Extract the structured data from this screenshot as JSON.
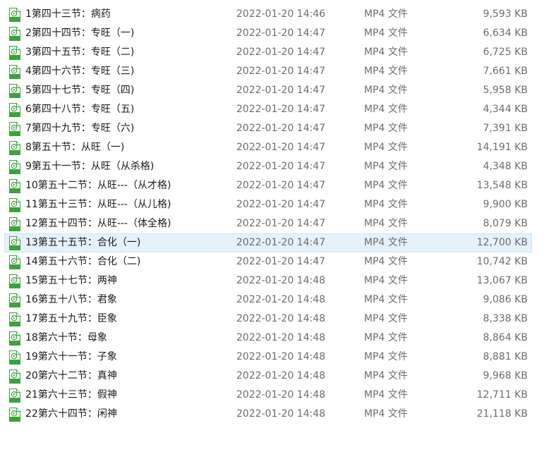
{
  "files": [
    {
      "name": "1第四十三节：病药",
      "date": "2022-01-20 14:46",
      "type": "MP4 文件",
      "size": "9,593 KB"
    },
    {
      "name": "2第四十四节：专旺（一)",
      "date": "2022-01-20 14:47",
      "type": "MP4 文件",
      "size": "6,634 KB"
    },
    {
      "name": "3第四十五节：专旺（二)",
      "date": "2022-01-20 14:47",
      "type": "MP4 文件",
      "size": "6,725 KB"
    },
    {
      "name": "4第四十六节：专旺（三)",
      "date": "2022-01-20 14:47",
      "type": "MP4 文件",
      "size": "7,661 KB"
    },
    {
      "name": "5第四十七节：专旺（四)",
      "date": "2022-01-20 14:47",
      "type": "MP4 文件",
      "size": "5,958 KB"
    },
    {
      "name": "6第四十八节：专旺（五)",
      "date": "2022-01-20 14:47",
      "type": "MP4 文件",
      "size": "4,344 KB"
    },
    {
      "name": "7第四十九节：专旺（六)",
      "date": "2022-01-20 14:47",
      "type": "MP4 文件",
      "size": "7,391 KB"
    },
    {
      "name": "8第五十节：从旺（一)",
      "date": "2022-01-20 14:47",
      "type": "MP4 文件",
      "size": "14,191 KB"
    },
    {
      "name": "9第五十一节：从旺（从杀格)",
      "date": "2022-01-20 14:47",
      "type": "MP4 文件",
      "size": "4,348 KB"
    },
    {
      "name": "10第五十二节：从旺---（从才格)",
      "date": "2022-01-20 14:47",
      "type": "MP4 文件",
      "size": "13,548 KB"
    },
    {
      "name": "11第五十三节：从旺---（从儿格)",
      "date": "2022-01-20 14:47",
      "type": "MP4 文件",
      "size": "9,900 KB"
    },
    {
      "name": "12第五十四节：从旺---（体全格)",
      "date": "2022-01-20 14:47",
      "type": "MP4 文件",
      "size": "8,079 KB"
    },
    {
      "name": "13第五十五节：合化（一)",
      "date": "2022-01-20 14:47",
      "type": "MP4 文件",
      "size": "12,700 KB",
      "selected": true
    },
    {
      "name": "14第五十六节：合化（二)",
      "date": "2022-01-20 14:47",
      "type": "MP4 文件",
      "size": "10,742 KB"
    },
    {
      "name": "15第五十七节：两神",
      "date": "2022-01-20 14:48",
      "type": "MP4 文件",
      "size": "13,067 KB"
    },
    {
      "name": "16第五十八节：君象",
      "date": "2022-01-20 14:48",
      "type": "MP4 文件",
      "size": "9,086 KB"
    },
    {
      "name": "17第五十九节：臣象",
      "date": "2022-01-20 14:48",
      "type": "MP4 文件",
      "size": "8,338 KB"
    },
    {
      "name": "18第六十节：母象",
      "date": "2022-01-20 14:48",
      "type": "MP4 文件",
      "size": "8,864 KB"
    },
    {
      "name": "19第六十一节：子象",
      "date": "2022-01-20 14:48",
      "type": "MP4 文件",
      "size": "8,881 KB"
    },
    {
      "name": "20第六十二节：真神",
      "date": "2022-01-20 14:48",
      "type": "MP4 文件",
      "size": "9,968 KB"
    },
    {
      "name": "21第六十三节：假神",
      "date": "2022-01-20 14:48",
      "type": "MP4 文件",
      "size": "12,711 KB"
    },
    {
      "name": "22第六十四节：闲神",
      "date": "2022-01-20 14:48",
      "type": "MP4 文件",
      "size": "21,118 KB"
    }
  ],
  "icon": {
    "name": "mp4-file-icon",
    "color": "#3ca23c"
  },
  "colors": {
    "selected_bg": "#e5f1fb",
    "selected_border": "#cce4f7"
  }
}
